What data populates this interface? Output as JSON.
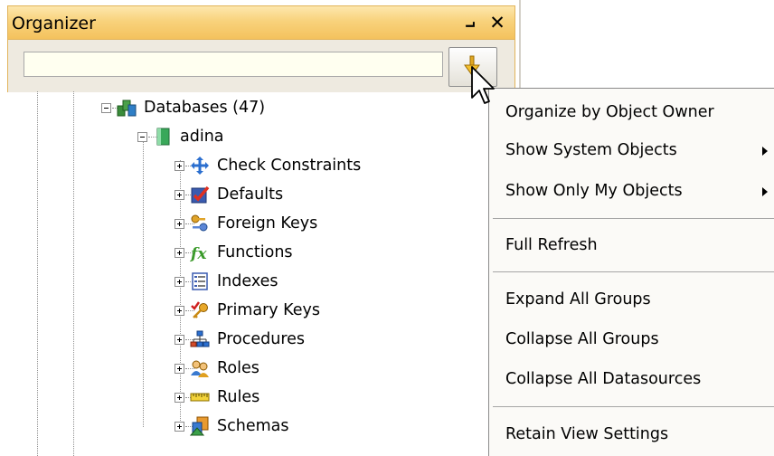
{
  "panel": {
    "title": "Organizer",
    "pin_glyph": "⨼",
    "close_glyph": "✕",
    "search": {
      "value": "",
      "placeholder": ""
    },
    "organize_button_icon": "organize-down-arrow-icon"
  },
  "tree": {
    "root": {
      "label": "Databases (47)",
      "icon": "databases-icon",
      "expanded": true
    },
    "database": {
      "label": "adina",
      "icon": "database-cylinder-icon",
      "expanded": true
    },
    "items": [
      {
        "label": "Check Constraints",
        "icon": "check-constraints-icon"
      },
      {
        "label": "Defaults",
        "icon": "defaults-icon"
      },
      {
        "label": "Foreign Keys",
        "icon": "foreign-keys-icon"
      },
      {
        "label": "Functions",
        "icon": "functions-icon"
      },
      {
        "label": "Indexes",
        "icon": "indexes-icon"
      },
      {
        "label": "Primary Keys",
        "icon": "primary-keys-icon"
      },
      {
        "label": "Procedures",
        "icon": "procedures-icon"
      },
      {
        "label": "Roles",
        "icon": "roles-icon"
      },
      {
        "label": "Rules",
        "icon": "rules-icon"
      },
      {
        "label": "Schemas",
        "icon": "schemas-icon"
      }
    ]
  },
  "menu": {
    "items": [
      {
        "label": "Organize by Object Owner",
        "submenu": false
      },
      {
        "label": "Show System Objects",
        "submenu": true
      },
      {
        "label": "Show Only My Objects",
        "submenu": true
      },
      {
        "label": "Full Refresh",
        "submenu": false
      },
      {
        "label": "Expand All Groups",
        "submenu": false
      },
      {
        "label": "Collapse All Groups",
        "submenu": false
      },
      {
        "label": "Collapse All Datasources",
        "submenu": false
      },
      {
        "label": "Retain View Settings",
        "submenu": false
      }
    ]
  },
  "colors": {
    "titlebar": "#f8d27c",
    "toolbar": "#eeeae0",
    "menu_bg": "#fbfaf7",
    "tree_line": "#909090"
  }
}
